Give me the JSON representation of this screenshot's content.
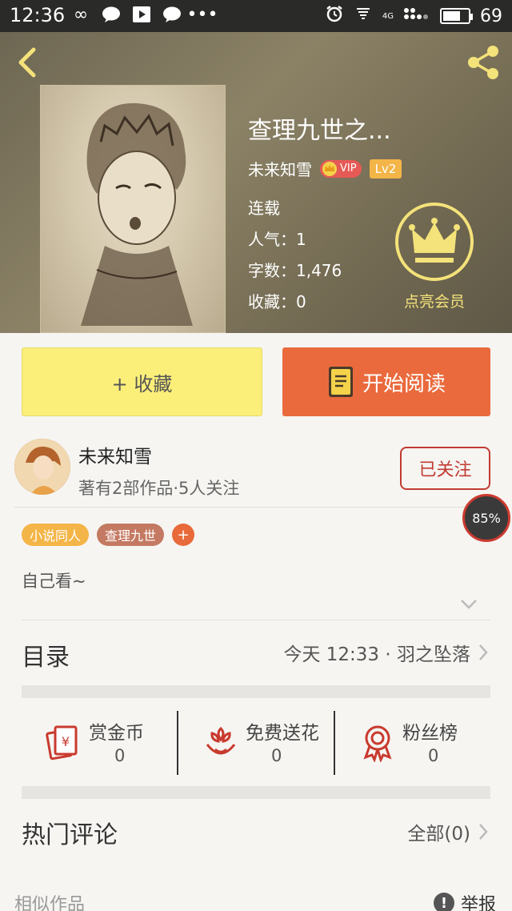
{
  "status_bar": {
    "time": "12:36",
    "battery": "69",
    "battery_fraction": 0.69,
    "network": "4G"
  },
  "header": {
    "back_icon": "back-arrow-icon",
    "share_icon": "share-icon"
  },
  "book": {
    "title": "查理九世之...",
    "author": "未来知雪",
    "vip_label": "VIP",
    "level": "Lv2",
    "status": "连载",
    "popularity": "人气：1",
    "word_count": "字数：1,476",
    "favorites": "收藏：0"
  },
  "membership": {
    "label": "点亮会员",
    "icon": "crown-icon",
    "color": "#f4e27a"
  },
  "actions": {
    "collect_label": "+ 收藏",
    "read_label": "开始阅读",
    "collect_color": "#fbef7a",
    "read_color": "#ea6a3d"
  },
  "author_card": {
    "name": "未来知雪",
    "meta": "著有2部作品·5人关注",
    "follow_label": "已关注"
  },
  "tags": [
    {
      "label": "小说同人",
      "color": "#f4b548"
    },
    {
      "label": "查理九世",
      "color": "#c47a62"
    }
  ],
  "tag_add_label": "+",
  "description": "自己看~",
  "toc": {
    "label": "目录",
    "latest": "今天 12:33 · 羽之坠落"
  },
  "stats": [
    {
      "label": "赏金币",
      "value": "0",
      "icon": "red-envelope-icon"
    },
    {
      "label": "免费送花",
      "value": "0",
      "icon": "flower-icon"
    },
    {
      "label": "粉丝榜",
      "value": "0",
      "icon": "medal-icon"
    }
  ],
  "comments": {
    "label": "热门评论",
    "all_label": "全部(0)"
  },
  "footer": {
    "similar_label": "相似作品",
    "report_label": "举报"
  },
  "progress_badge": "85%"
}
